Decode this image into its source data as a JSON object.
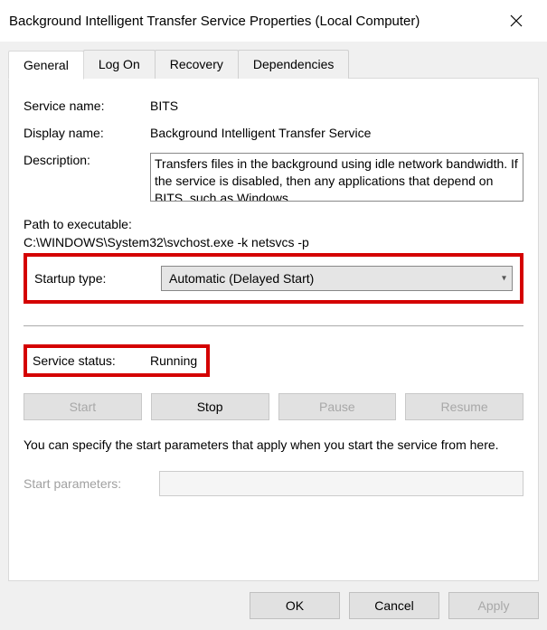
{
  "window": {
    "title": "Background Intelligent Transfer Service Properties (Local Computer)"
  },
  "tabs": {
    "general": "General",
    "logon": "Log On",
    "recovery": "Recovery",
    "dependencies": "Dependencies"
  },
  "labels": {
    "service_name": "Service name:",
    "display_name": "Display name:",
    "description": "Description:",
    "path_to_exe": "Path to executable:",
    "startup_type": "Startup type:",
    "service_status": "Service status:",
    "start_parameters": "Start parameters:"
  },
  "values": {
    "service_name": "BITS",
    "display_name": "Background Intelligent Transfer Service",
    "description": "Transfers files in the background using idle network bandwidth. If the service is disabled, then any applications that depend on BITS, such as Windows",
    "path": "C:\\WINDOWS\\System32\\svchost.exe -k netsvcs -p",
    "startup_type": "Automatic (Delayed Start)",
    "service_status": "Running",
    "start_parameters": ""
  },
  "buttons": {
    "start": "Start",
    "stop": "Stop",
    "pause": "Pause",
    "resume": "Resume",
    "ok": "OK",
    "cancel": "Cancel",
    "apply": "Apply"
  },
  "note": "You can specify the start parameters that apply when you start the service from here."
}
